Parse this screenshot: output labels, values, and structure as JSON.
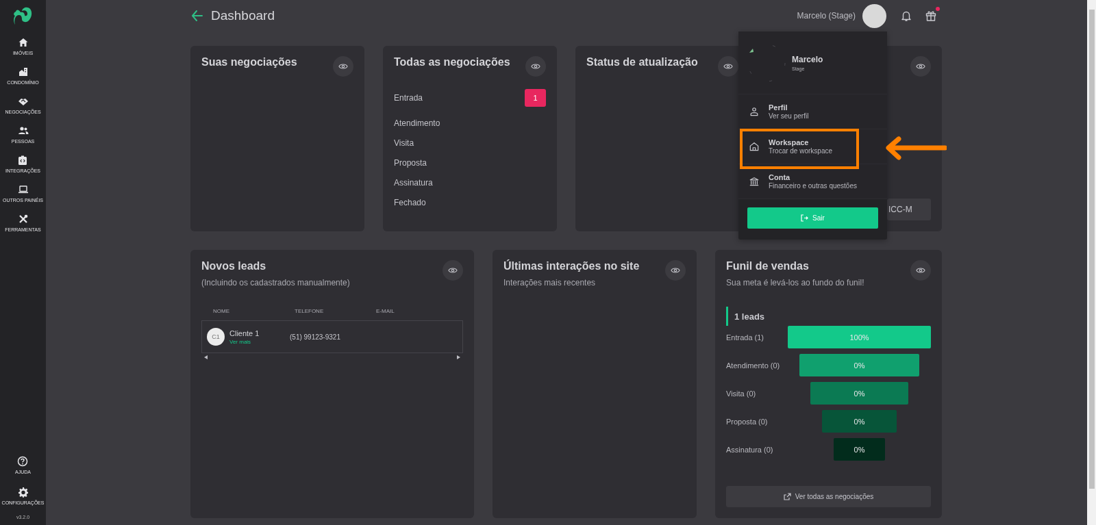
{
  "sidebar": {
    "items": [
      {
        "label": "IMÓVEIS",
        "selected": false
      },
      {
        "label": "CONDOMÍNIO",
        "selected": false
      },
      {
        "label": "NEGOCIAÇÕES",
        "selected": false
      },
      {
        "label": "PESSOAS",
        "selected": false
      },
      {
        "label": "INTEGRAÇÕES",
        "selected": false
      },
      {
        "label": "OUTROS PAINÉIS",
        "selected": false
      },
      {
        "label": "FERRAMENTAS",
        "selected": false
      }
    ],
    "bottom_items": [
      {
        "label": "AJUDA",
        "selected": false
      },
      {
        "label": "CONFIGURAÇÕES",
        "selected": false
      }
    ],
    "version": "v3.2.0"
  },
  "header": {
    "title": "Dashboard",
    "user_name": "Marcelo (Stage)",
    "gift_badge": true
  },
  "top_cards": [
    {
      "title": "Suas negociações"
    },
    {
      "title": "Todas as negociações",
      "stages": [
        {
          "label": "Entrada",
          "count": "1"
        },
        {
          "label": "Atendimento"
        },
        {
          "label": "Visita"
        },
        {
          "label": "Proposta"
        },
        {
          "label": "Assinatura"
        },
        {
          "label": "Fechado"
        }
      ]
    },
    {
      "title": "Status de atualização"
    },
    {
      "button": "ICC-M"
    }
  ],
  "leads": {
    "title": "Novos leads",
    "subtitle": "(Incluindo os cadastrados manualmente)",
    "columns": [
      "NOME",
      "TELEFONE",
      "E-MAIL"
    ],
    "rows": [
      {
        "initials": "C1",
        "name": "Cliente 1",
        "link": "Ver mais",
        "phone": "(51) 99123-9321"
      }
    ]
  },
  "interactions": {
    "title": "Últimas interações no site",
    "subtitle": "Interações mais recentes"
  },
  "funnel": {
    "title": "Funil de vendas",
    "subtitle": "Sua meta é levá-los ao fundo do funil!",
    "total": "1 leads",
    "stages": [
      {
        "label": "Entrada (1)",
        "percent": "100%",
        "color": "#13c98a"
      },
      {
        "label": "Atendimento (0)",
        "percent": "0%",
        "color": "#10a06e"
      },
      {
        "label": "Visita (0)",
        "percent": "0%",
        "color": "#0b7a53"
      },
      {
        "label": "Proposta (0)",
        "percent": "0%",
        "color": "#075539"
      },
      {
        "label": "Assinatura (0)",
        "percent": "0%",
        "color": "#022c1c"
      }
    ],
    "button": "Ver todas as negociações"
  },
  "user_menu": {
    "name": "Marcelo",
    "subtitle": "Stage",
    "items": [
      {
        "title": "Perfil",
        "subtitle": "Ver seu perfil",
        "highlighted": false
      },
      {
        "title": "Workspace",
        "subtitle": "Trocar de workspace",
        "highlighted": true
      },
      {
        "title": "Conta",
        "subtitle": "Financeiro e outras questões",
        "highlighted": false
      }
    ],
    "logout": "Sair"
  }
}
